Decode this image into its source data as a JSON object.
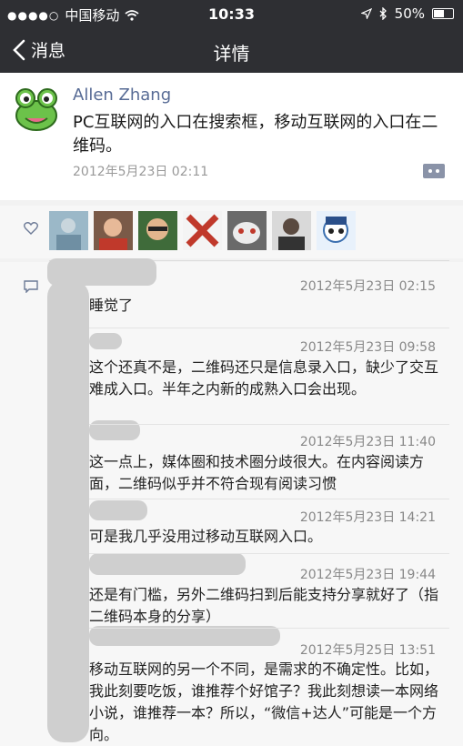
{
  "status": {
    "carrier": "中国移动",
    "time": "10:33",
    "battery": "50%",
    "battery_level": 0.5
  },
  "nav": {
    "back_label": "消息",
    "title": "详情"
  },
  "post": {
    "author": "Allen Zhang",
    "text": "PC互联网的入口在搜索框，移动互联网的入口在二维码。",
    "time": "2012年5月23日 02:11"
  },
  "comments": [
    {
      "time": "2012年5月23日 02:15",
      "text": "睡觉了"
    },
    {
      "time": "2012年5月23日 09:58",
      "text": "这个还真不是，二维码还只是信息录入口，缺少了交互难成入口。半年之内新的成熟入口会出现。"
    },
    {
      "time": "2012年5月23日 11:40",
      "text": "这一点上，媒体圈和技术圈分歧很大。在内容阅读方面，二维码似乎并不符合现有阅读习惯"
    },
    {
      "time": "2012年5月23日 14:21",
      "text": "可是我几乎没用过移动互联网入口。"
    },
    {
      "time": "2012年5月23日 19:44",
      "text": "还是有门槛，另外二维码扫到后能支持分享就好了（指二维码本身的分享）"
    },
    {
      "time": "2012年5月25日 13:51",
      "text": "移动互联网的另一个不同，是需求的不确定性。比如，我此刻要吃饭，谁推荐个好馆子？我此刻想读一本网络小说，谁推荐一本？所以，“微信+达人”可能是一个方向。"
    }
  ],
  "icons": {
    "back": "chevron-left-icon",
    "wifi": "wifi-icon",
    "location": "location-arrow-icon",
    "bluetooth": "bluetooth-icon",
    "battery": "battery-icon",
    "like": "heart-icon",
    "comment": "comment-icon",
    "more": "more-dots-icon"
  }
}
